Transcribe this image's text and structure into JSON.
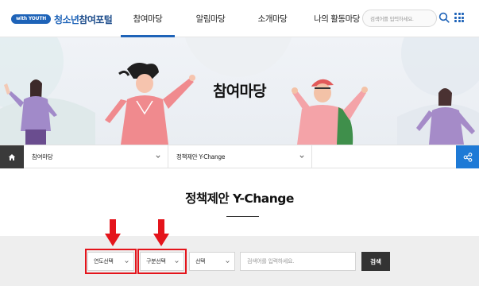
{
  "header": {
    "logo_badge": "with YOUTH",
    "logo_text_a": "청소년",
    "logo_text_b": "참여포털",
    "nav": [
      {
        "label": "참여마당",
        "active": true
      },
      {
        "label": "알림마당",
        "active": false
      },
      {
        "label": "소개마당",
        "active": false
      },
      {
        "label": "나의 활동마당",
        "active": false
      }
    ],
    "search_placeholder": "검색어를 입력하세요.",
    "accent": "#1e63b8"
  },
  "banner": {
    "title": "참여마당"
  },
  "breadcrumb": {
    "level1": "참여마당",
    "level2": "정책제안 Y-Change"
  },
  "page": {
    "title": "정책제안 Y-Change"
  },
  "filters": {
    "year_select": "연도선택",
    "type_select": "구분선택",
    "option_select": "선택",
    "keyword_placeholder": "검색어를 입력하세요.",
    "search_button": "검색",
    "highlight_color": "#e4141b"
  },
  "icons": {
    "home": "home-icon",
    "share": "share-icon",
    "search": "search-icon",
    "menu": "grid-menu-icon"
  }
}
